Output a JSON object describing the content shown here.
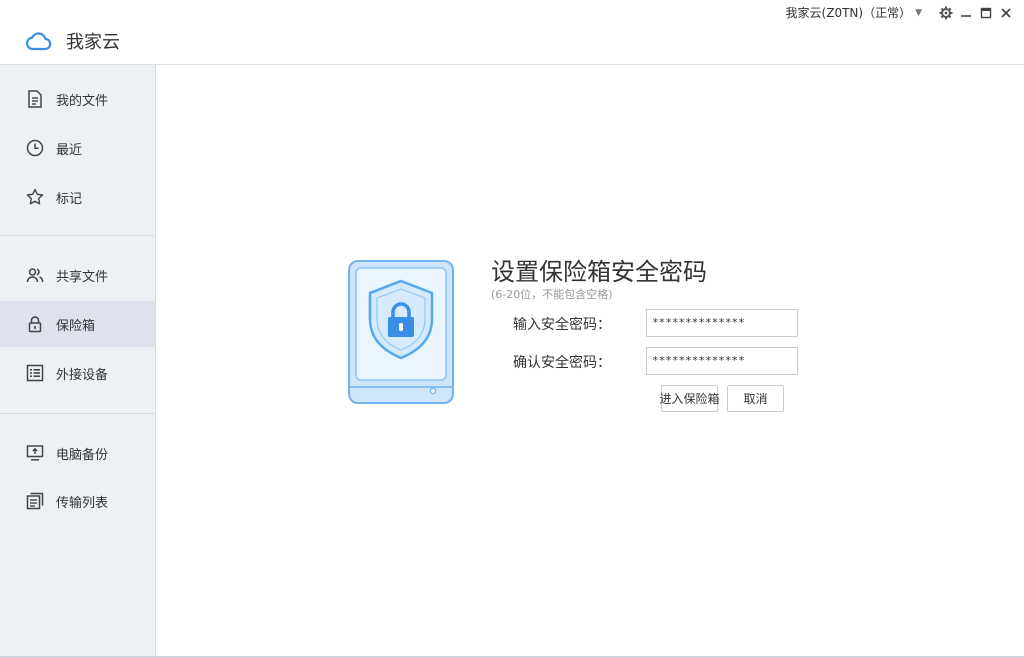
{
  "app": {
    "name": "我家云"
  },
  "titlebar": {
    "account": "我家云(Z0TN)（正常）"
  },
  "sidebar": {
    "items": [
      {
        "label": "我的文件",
        "icon": "file-icon"
      },
      {
        "label": "最近",
        "icon": "clock-icon"
      },
      {
        "label": "标记",
        "icon": "star-icon"
      },
      {
        "label": "共享文件",
        "icon": "users-icon"
      },
      {
        "label": "保险箱",
        "icon": "lock-icon",
        "active": true
      },
      {
        "label": "外接设备",
        "icon": "device-list-icon"
      },
      {
        "label": "电脑备份",
        "icon": "monitor-upload-icon"
      },
      {
        "label": "传输列表",
        "icon": "transfer-list-icon"
      }
    ]
  },
  "vault": {
    "title": "设置保险箱安全密码",
    "hint": "(6-20位，不能包含空格)",
    "password_label": "输入安全密码：",
    "password_value": "**************",
    "confirm_label": "确认安全密码：",
    "confirm_value": "**************",
    "enter_button": "进入保险箱",
    "cancel_button": "取消"
  },
  "colors": {
    "accent": "#3a8ee6",
    "sidebar_bg": "#edf0f5",
    "sidebar_active": "#dde2ec"
  }
}
